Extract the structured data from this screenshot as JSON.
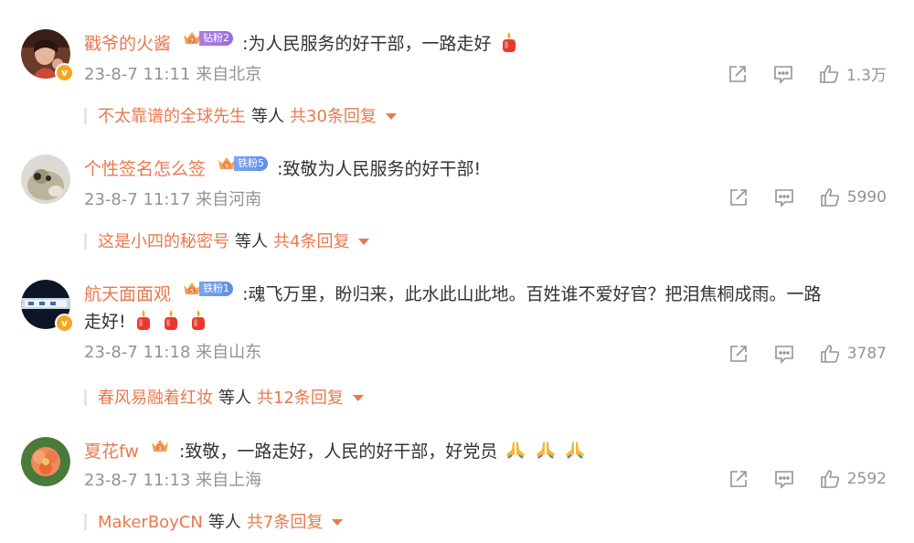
{
  "cut_top": {
    "left": "...",
    "right": "..."
  },
  "comments": [
    {
      "author": "戳爷的火酱",
      "fan_level": "钻粉2",
      "fan_color": "purple",
      "verified": true,
      "text": ":为人民服务的好干部，一路走好",
      "emoji": [
        "candle"
      ],
      "time": "23-8-7 11:11",
      "location": "来自北京",
      "likes": "1.3万",
      "reply_user": "不太靠谱的全球先生",
      "reply_etc": "等人",
      "reply_count": "共30条回复"
    },
    {
      "author": "个性签名怎么签",
      "fan_level": "铁粉5",
      "fan_color": "blue",
      "verified": false,
      "text": ":致敬为人民服务的好干部!",
      "emoji": [],
      "time": "23-8-7 11:17",
      "location": "来自河南",
      "likes": "5990",
      "reply_user": "这是小四的秘密号",
      "reply_etc": "等人",
      "reply_count": "共4条回复"
    },
    {
      "author": "航天面面观",
      "fan_level": "铁粉1",
      "fan_color": "blue",
      "verified": true,
      "text": ":魂飞万里，盼归来，此水此山此地。百姓谁不爱好官？把泪焦桐成雨。一路",
      "text_line2": "走好!",
      "emoji": [
        "candle",
        "candle",
        "candle"
      ],
      "time": "23-8-7 11:18",
      "location": "来自山东",
      "likes": "3787",
      "reply_user": "春风易融着红妆",
      "reply_etc": "等人",
      "reply_count": "共12条回复"
    },
    {
      "author": "夏花fw",
      "fan_level": "",
      "fan_color": "",
      "verified": false,
      "text": ":致敬，一路走好，人民的好干部，好党员",
      "emoji": [
        "pray",
        "pray",
        "pray"
      ],
      "time": "23-8-7 11:13",
      "location": "来自上海",
      "likes": "2592",
      "reply_user": "MakerBoyCN",
      "reply_etc": "等人",
      "reply_count": "共7条回复"
    }
  ],
  "colors": {
    "accent": "#e8794f",
    "meta_gray": "#939393",
    "verified_badge": "#f5a623",
    "candle_red": "#e8392f"
  },
  "icons": [
    "share-icon",
    "comment-icon",
    "like-icon",
    "candle-emoji",
    "pray-emoji",
    "crown-icon",
    "caret-down-icon"
  ]
}
